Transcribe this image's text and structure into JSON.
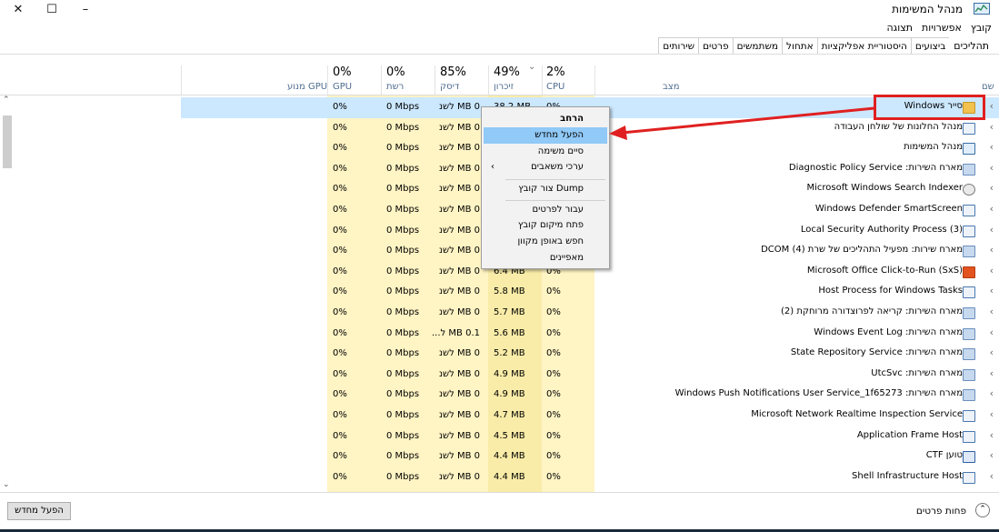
{
  "window": {
    "title": "מנהל המשימות",
    "close_glyph": "✕",
    "maximize_glyph": "☐",
    "minimize_glyph": "–"
  },
  "menu": [
    "קובץ",
    "אפשרויות",
    "תצוגה"
  ],
  "tabs": [
    "תהליכים",
    "ביצועים",
    "היסטוריית אפליקציות",
    "אתחול",
    "משתמשים",
    "פרטים",
    "שירותים"
  ],
  "header": {
    "name": "שם",
    "status": "מצב",
    "cpu_pct": "2%",
    "cpu_label": "CPU",
    "mem_pct": "49%",
    "mem_label": "זיכרון",
    "mem_sort": "⌄",
    "disk_pct": "85%",
    "disk_label": "דיסק",
    "net_pct": "0%",
    "net_label": "רשת",
    "gpu_pct": "0%",
    "gpu_label": "GPU",
    "gpu_engine_label": "מנוע GPU"
  },
  "rows": [
    {
      "name": "סייר Windows",
      "icon": "folder-icon",
      "cpu": "0%",
      "mem": "38.2 MB",
      "disk": "0 MB לשנ",
      "net": "0 Mbps",
      "gpu": "0%"
    },
    {
      "name": "מנהל החלונות של שולחן העבודה",
      "icon": "app-window-icon",
      "cpu": "0%",
      "mem": "",
      "disk": "0 MB לשנ",
      "net": "0 Mbps",
      "gpu": "0%"
    },
    {
      "name": "מנהל המשימות",
      "icon": "task-manager-icon",
      "cpu": "0%",
      "mem": "",
      "disk": "0 MB לשנ",
      "net": "0 Mbps",
      "gpu": "0%"
    },
    {
      "name": "מארח השירות: Diagnostic Policy Service",
      "icon": "gear-icon",
      "cpu": "0%",
      "mem": "",
      "disk": "0 MB לשנ",
      "net": "0 Mbps",
      "gpu": "0%"
    },
    {
      "name": "Microsoft Windows Search Indexer",
      "icon": "search-indexer-icon",
      "cpu": "0%",
      "mem": "",
      "disk": "0 MB לשנ",
      "net": "0 Mbps",
      "gpu": "0%"
    },
    {
      "name": "Windows Defender SmartScreen",
      "icon": "app-window-icon",
      "cpu": "0%",
      "mem": "",
      "disk": "0 MB לשנ",
      "net": "0 Mbps",
      "gpu": "0%"
    },
    {
      "name": "Local Security Authority Process (3)",
      "icon": "app-window-icon",
      "cpu": "0%",
      "mem": "",
      "disk": "0 MB לשנ",
      "net": "0 Mbps",
      "gpu": "0%"
    },
    {
      "name": "מארח שירות: מפעיל התהליכים של שרת DCOM (4)",
      "icon": "gear-icon",
      "cpu": "0%",
      "mem": "",
      "disk": "0 MB לשנ",
      "net": "0 Mbps",
      "gpu": "0%"
    },
    {
      "name": "Microsoft Office Click-to-Run (SxS)",
      "icon": "office-icon",
      "cpu": "0%",
      "mem": "6.4 MB",
      "disk": "0 MB לשנ",
      "net": "0 Mbps",
      "gpu": "0%"
    },
    {
      "name": "Host Process for Windows Tasks",
      "icon": "app-window-icon",
      "cpu": "0%",
      "mem": "5.8 MB",
      "disk": "0 MB לשנ",
      "net": "0 Mbps",
      "gpu": "0%"
    },
    {
      "name": "מארח השירות: קריאה לפרוצדורה מרוחקת (2)",
      "icon": "gear-icon",
      "cpu": "0%",
      "mem": "5.7 MB",
      "disk": "0 MB לשנ",
      "net": "0 Mbps",
      "gpu": "0%"
    },
    {
      "name": "מארח השירות: Windows Event Log",
      "icon": "gear-icon",
      "cpu": "0%",
      "mem": "5.6 MB",
      "disk": "0.1 MB ל...",
      "net": "0 Mbps",
      "gpu": "0%"
    },
    {
      "name": "מארח השירות: State Repository Service",
      "icon": "gear-icon",
      "cpu": "0%",
      "mem": "5.2 MB",
      "disk": "0 MB לשנ",
      "net": "0 Mbps",
      "gpu": "0%"
    },
    {
      "name": "מארח השירות: UtcSvc",
      "icon": "gear-icon",
      "cpu": "0%",
      "mem": "4.9 MB",
      "disk": "0 MB לשנ",
      "net": "0 Mbps",
      "gpu": "0%"
    },
    {
      "name": "מארח השירות: Windows Push Notifications User Service_1f65273",
      "icon": "gear-icon",
      "cpu": "0%",
      "mem": "4.9 MB",
      "disk": "0 MB לשנ",
      "net": "0 Mbps",
      "gpu": "0%"
    },
    {
      "name": "Microsoft Network Realtime Inspection Service",
      "icon": "app-window-icon",
      "cpu": "0%",
      "mem": "4.7 MB",
      "disk": "0 MB לשנ",
      "net": "0 Mbps",
      "gpu": "0%"
    },
    {
      "name": "Application Frame Host",
      "icon": "app-window-icon",
      "cpu": "0%",
      "mem": "4.5 MB",
      "disk": "0 MB לשנ",
      "net": "0 Mbps",
      "gpu": "0%"
    },
    {
      "name": "טוען CTF",
      "icon": "ctf-loader-icon",
      "cpu": "0%",
      "mem": "4.4 MB",
      "disk": "0 MB לשנ",
      "net": "0 Mbps",
      "gpu": "0%"
    },
    {
      "name": "Shell Infrastructure Host",
      "icon": "app-window-icon",
      "cpu": "0%",
      "mem": "4.4 MB",
      "disk": "0 MB לשנ",
      "net": "0 Mbps",
      "gpu": "0%"
    }
  ],
  "context_menu": {
    "expand": "הרחב",
    "restart": "הפעל מחדש",
    "end_task": "סיים משימה",
    "resource_values": "ערכי משאבים",
    "resource_values_arrow": "‹",
    "create_dump": "צור קובץ Dump",
    "go_to_details": "עבור לפרטים",
    "open_file_location": "פתח מיקום קובץ",
    "search_online": "חפש באופן מקוון",
    "properties": "מאפיינים"
  },
  "footer": {
    "restart_button": "הפעל מחדש",
    "less_details": "פחות פרטים",
    "less_icon_glyph": "⌃"
  },
  "colors": {
    "selected_row": "#cce8ff",
    "heat_light": "#fff4c4",
    "heat_medium": "#f9eca8",
    "heat_strong": "#f4e08f",
    "menu_highlight": "#91c9f7",
    "annotation_red": "#e02020"
  }
}
